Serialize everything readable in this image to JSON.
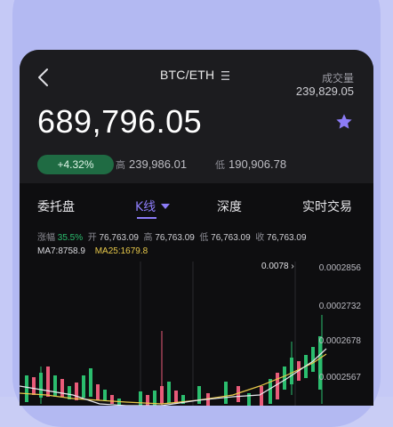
{
  "header": {
    "pair": "BTC/ETH",
    "menu_icon": "hamburger-icon",
    "back_icon": "chevron-left-icon",
    "volume_label": "成交量",
    "volume_value": "239,829.05",
    "favorite_icon": "star-icon"
  },
  "price": {
    "last": "689,796.05",
    "change": "+4.32%",
    "high_label": "高",
    "high_value": "239,986.01",
    "low_label": "低",
    "low_value": "190,906.78"
  },
  "tabs": [
    {
      "label": "委托盘",
      "active": false
    },
    {
      "label": "K线",
      "active": true
    },
    {
      "label": "深度",
      "active": false
    },
    {
      "label": "实时交易",
      "active": false
    }
  ],
  "stats": {
    "change_label": "涨幅",
    "change_value": "35.5%",
    "open_label": "开",
    "open_value": "76,763.09",
    "high_label": "高",
    "high_value": "76,763.09",
    "low_label": "低",
    "low_value": "76,763.09",
    "close_label": "收",
    "close_value": "76,763.09",
    "ma7": "MA7:8758.9",
    "ma25": "MA25:1679.8"
  },
  "chart": {
    "max_marker": "0.0078",
    "y_labels": [
      "0.0002856",
      "0.0002732",
      "0.0002678",
      "0.0002567"
    ]
  },
  "colors": {
    "accent": "#8c7cf7",
    "up": "#2bbd6e",
    "down": "#e85b79",
    "ma25": "#e8c94a",
    "badge_bg": "#1f6b43"
  }
}
